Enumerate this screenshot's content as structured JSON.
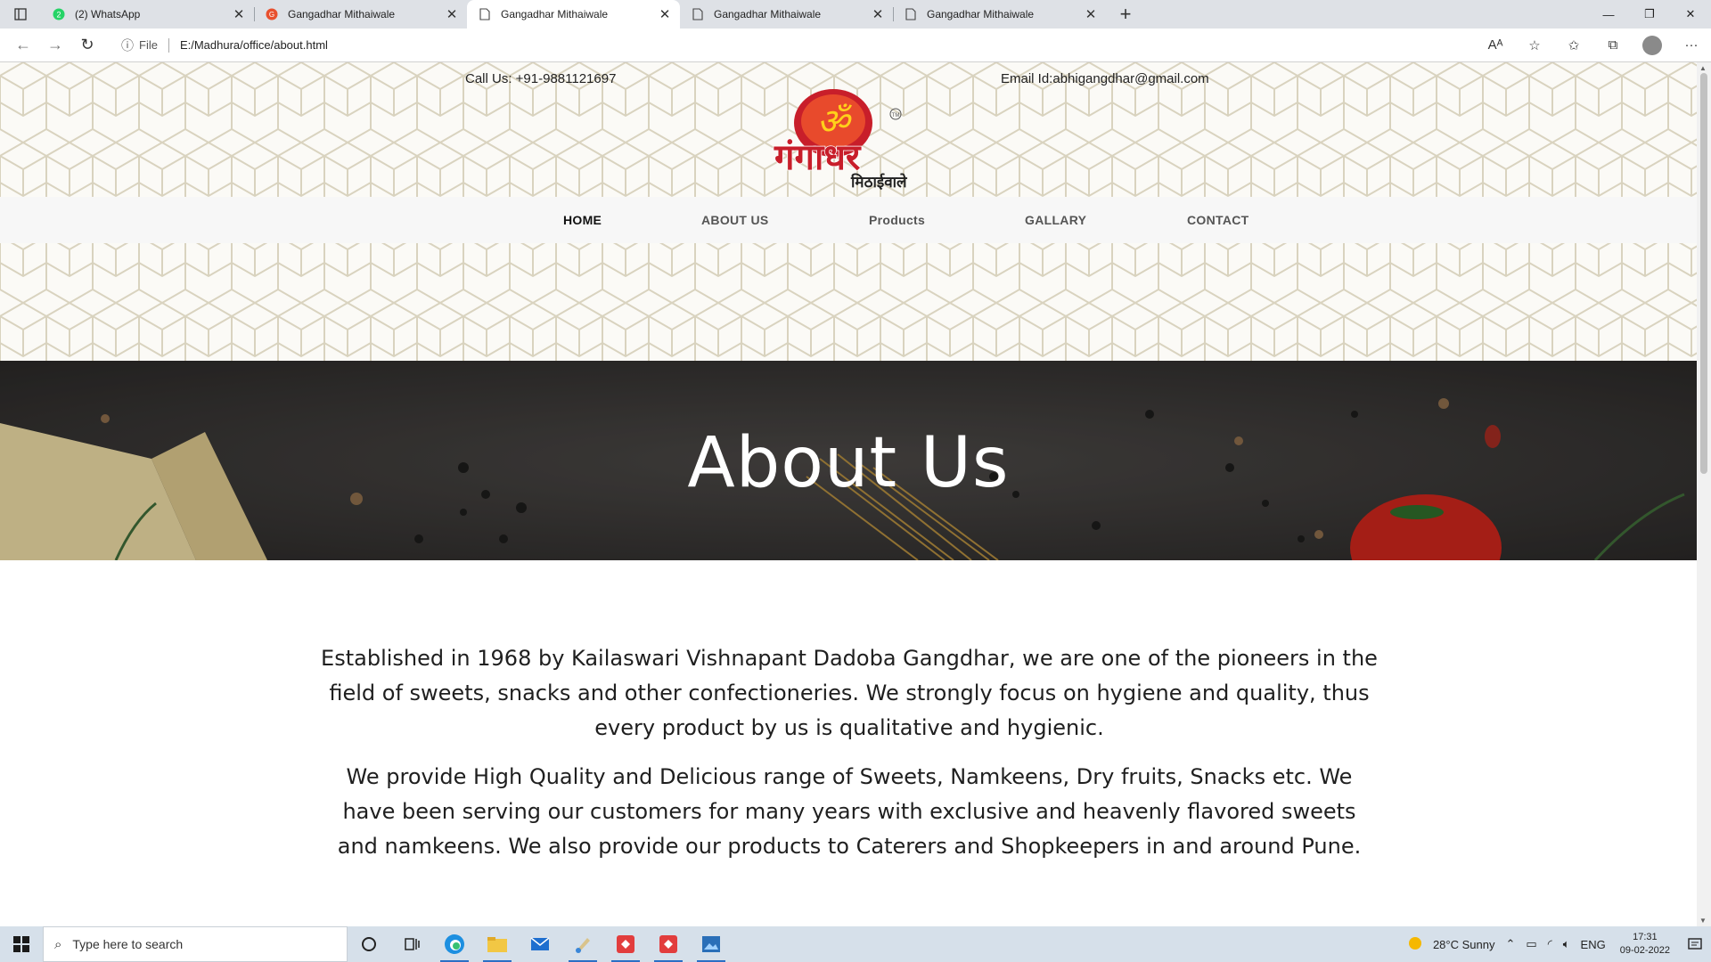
{
  "browser": {
    "tabs": [
      {
        "title": "(2) WhatsApp",
        "icon": "whatsapp-icon",
        "active": false
      },
      {
        "title": "Gangadhar Mithaiwale",
        "icon": "site-logo-icon",
        "active": false
      },
      {
        "title": "Gangadhar Mithaiwale",
        "icon": "page-icon",
        "active": true
      },
      {
        "title": "Gangadhar Mithaiwale",
        "icon": "page-icon",
        "active": false
      },
      {
        "title": "Gangadhar Mithaiwale",
        "icon": "page-icon",
        "active": false
      }
    ],
    "address": {
      "scheme_label": "File",
      "url": "E:/Madhura/office/about.html"
    }
  },
  "site": {
    "call": "Call Us: +91-9881121697",
    "email": "Email Id:abhigangdhar@gmail.com",
    "logo": {
      "script_text": "गंगाधर",
      "sub_text": "मिठाईवाले",
      "mark": "TM",
      "accent_color": "#c81e2a"
    },
    "nav": [
      {
        "label": "HOME",
        "active": true
      },
      {
        "label": "ABOUT US",
        "active": false
      },
      {
        "label": "Products",
        "active": false
      },
      {
        "label": "GALLARY",
        "active": false
      },
      {
        "label": "CONTACT",
        "active": false
      }
    ],
    "banner_title": "About Us",
    "paragraphs": [
      "Established in 1968 by Kailaswari Vishnapant Dadoba Gangdhar, we are one of the pioneers in the field of sweets, snacks and other confectioneries. We strongly focus on hygiene and quality, thus every product by us is qualitative and hygienic.",
      "We provide High Quality and Delicious range of Sweets, Namkeens, Dry fruits, Snacks etc. We have been serving our customers for many years with exclusive and heavenly flavored sweets and namkeens. We also provide our products to Caterers and Shopkeepers in and around Pune."
    ]
  },
  "taskbar": {
    "search_placeholder": "Type here to search",
    "weather": "28°C  Sunny",
    "language": "ENG",
    "time": "17:31",
    "date": "09-02-2022"
  },
  "colors": {
    "pattern_line": "#d9d3bf",
    "banner_bg": "#3c3a38",
    "taskbar_bg": "#d6e0ea"
  }
}
